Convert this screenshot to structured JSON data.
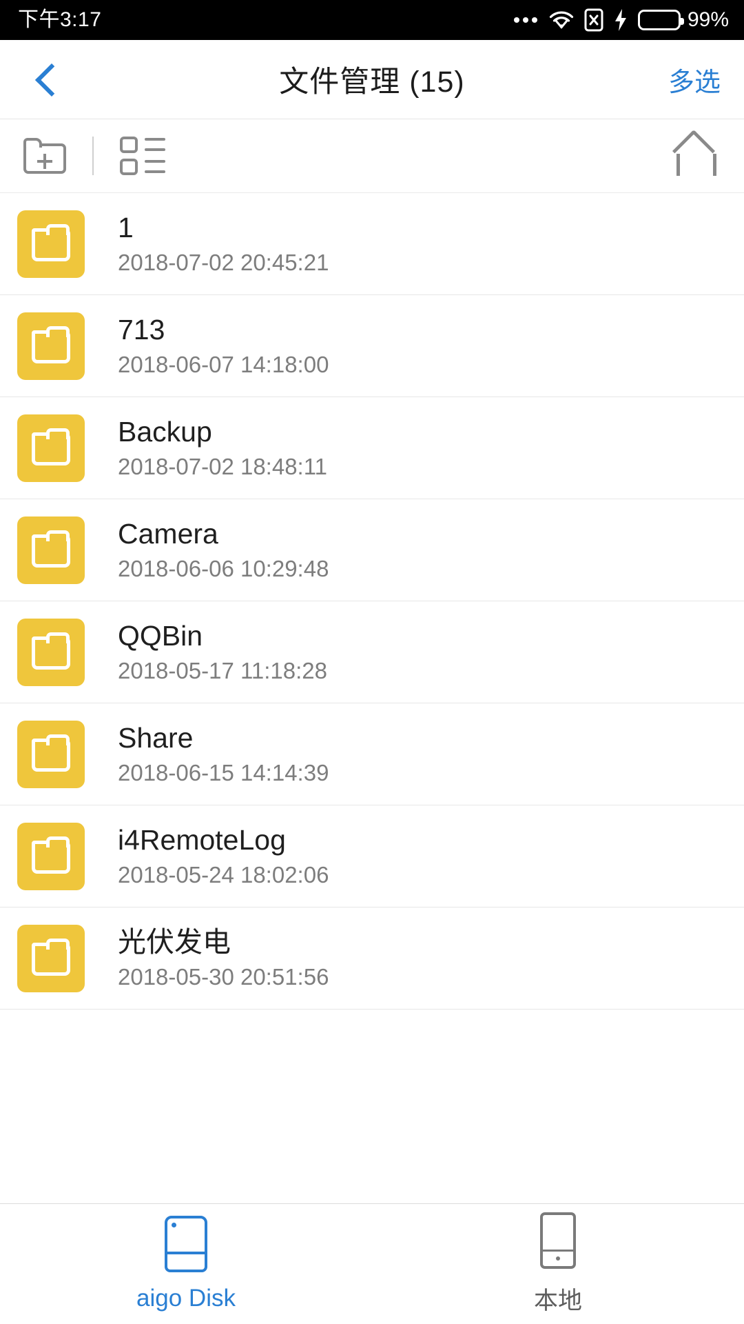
{
  "status_bar": {
    "time": "下午3:17",
    "battery_percent": "99%",
    "icons": [
      "more-dots-icon",
      "wifi-icon",
      "sim-disabled-icon",
      "charging-bolt-icon",
      "battery-icon"
    ],
    "battery_color": "#25d400",
    "background": "#000000"
  },
  "header": {
    "back_icon": "back-chevron-icon",
    "title": "文件管理 (15)",
    "multi_select_label": "多选",
    "accent_color": "#2a7fd3"
  },
  "toolbar": {
    "new_folder_icon": "new-folder-icon",
    "list_view_icon": "list-view-icon",
    "home_icon": "home-icon",
    "icon_color": "#8a8a8a"
  },
  "file_list": {
    "folder_icon_color": "#efc63c",
    "items": [
      {
        "name": "1",
        "date": "2018-07-02 20:45:21",
        "type": "folder"
      },
      {
        "name": "713",
        "date": "2018-06-07 14:18:00",
        "type": "folder"
      },
      {
        "name": "Backup",
        "date": "2018-07-02 18:48:11",
        "type": "folder"
      },
      {
        "name": "Camera",
        "date": "2018-06-06 10:29:48",
        "type": "folder"
      },
      {
        "name": "QQBin",
        "date": "2018-05-17 11:18:28",
        "type": "folder"
      },
      {
        "name": "Share",
        "date": "2018-06-15 14:14:39",
        "type": "folder"
      },
      {
        "name": "i4RemoteLog",
        "date": "2018-05-24 18:02:06",
        "type": "folder"
      },
      {
        "name": "光伏发电",
        "date": "2018-05-30 20:51:56",
        "type": "folder"
      }
    ]
  },
  "tab_bar": {
    "tabs": [
      {
        "label": "aigo Disk",
        "icon": "usb-disk-icon",
        "active": true
      },
      {
        "label": "本地",
        "icon": "phone-icon",
        "active": false
      }
    ],
    "active_color": "#2a7fd3",
    "inactive_color": "#5e5e5e"
  }
}
